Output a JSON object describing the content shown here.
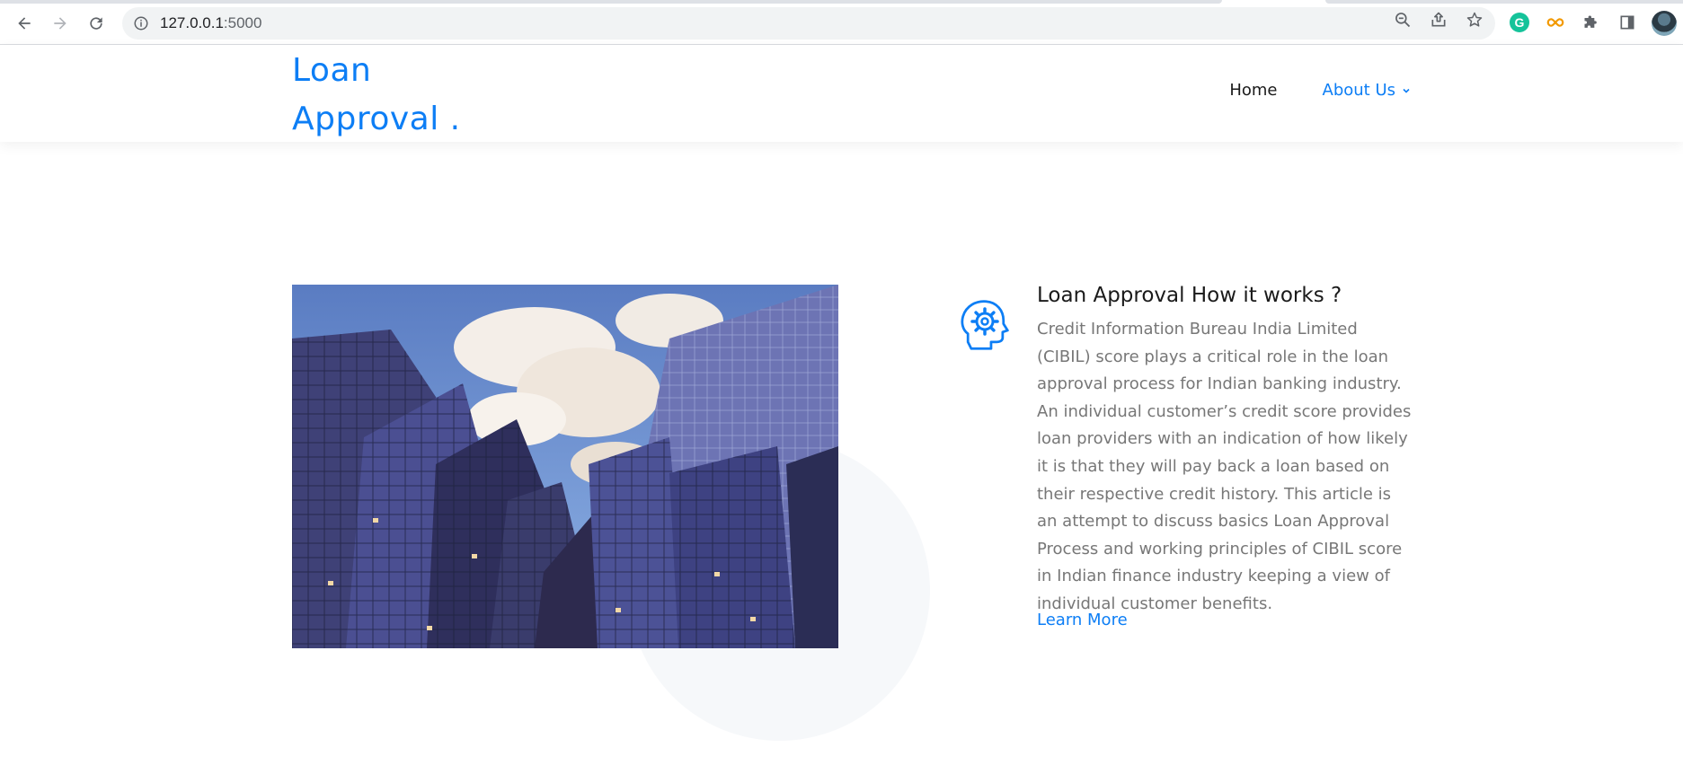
{
  "browser": {
    "url_host": "127.0.0.1",
    "url_port": ":5000"
  },
  "header": {
    "logo_line1": "Loan",
    "logo_line2": "Approval .",
    "nav": [
      {
        "label": "Home"
      },
      {
        "label": "About Us"
      }
    ]
  },
  "feature": {
    "title": "Loan Approval How it works ?",
    "body": "Credit Information Bureau India Limited (CIBIL) score plays a critical role in the loan approval process for Indian banking industry. An individual customer’s credit score provides loan providers with an indication of how likely it is that they will pay back a loan based on their respective credit history. This article is an attempt to discuss basics Loan Approval Process and working principles of CIBIL score in Indian finance industry keeping a view of individual customer benefits.",
    "link_label": "Learn More"
  },
  "colors": {
    "accent": "#0d7ef5",
    "body_text": "#777777",
    "heading": "#1a1a1a"
  },
  "icons": {
    "feature": "head-gear-icon"
  }
}
